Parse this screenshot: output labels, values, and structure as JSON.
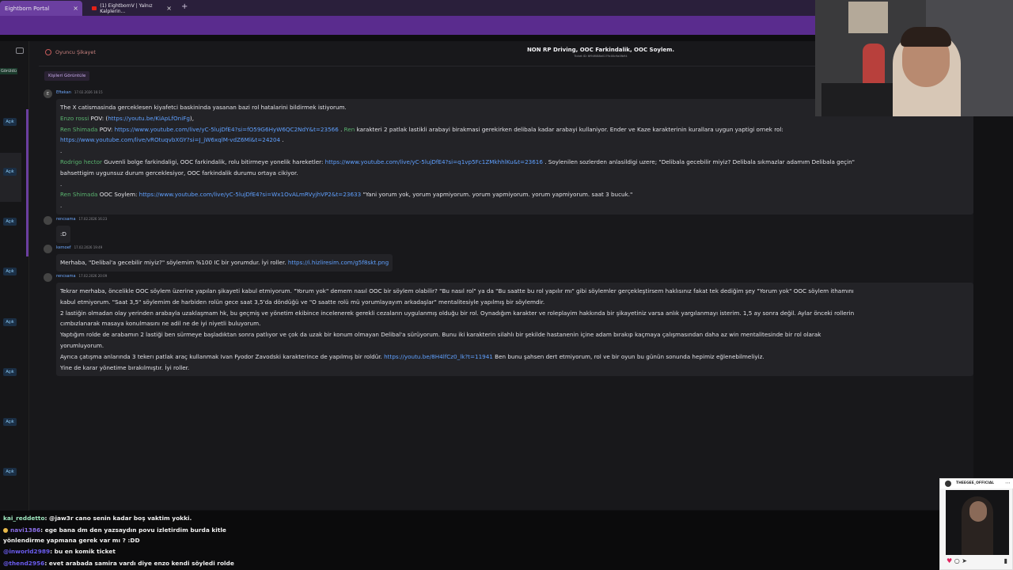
{
  "browser": {
    "tabs": [
      {
        "label": "Eightborn Portal",
        "active": true
      },
      {
        "label": "(1) EightbornV | Yalnız Kalplerin...",
        "active": false
      }
    ],
    "new_tab": "+",
    "close": "×"
  },
  "sidebar": {
    "status_top": "Görüldü",
    "status_items": [
      "Açık",
      "Açık",
      "Açık",
      "Açık",
      "Açık",
      "Açık",
      "Açık",
      "Açık"
    ]
  },
  "ticket": {
    "category": "Oyuncu Şikayet",
    "title": "NON RP Driving, OOC Farkindalik, OOC Soylem.",
    "id_line": "Ticket ID: 6f94f088e0179c00c9a0fb94",
    "people_button": "Kişileri Görüntüle"
  },
  "messages": [
    {
      "avatar_letter": "E",
      "author": "Eftekan",
      "time": "17.02.2026 16:15",
      "lines": [
        [
          {
            "t": "The X catismasinda gerceklesen kiyafetci baskininda yasanan bazi rol hatalarini bildirmek istiyorum."
          }
        ],
        [
          {
            "t": "Enzo rossi",
            "c": "g"
          },
          {
            "t": " POV: ("
          },
          {
            "t": "https://youtu.be/KiApLfOniFg",
            "c": "l"
          },
          {
            "t": "),"
          }
        ],
        [
          {
            "t": "Ren Shimada",
            "c": "g"
          },
          {
            "t": " POV: "
          },
          {
            "t": "https://www.youtube.com/live/yC-5lujDfE4?si=fO59G6HyW6QC2NdY&t=23566",
            "c": "l"
          },
          {
            "t": " . "
          },
          {
            "t": "Ren",
            "c": "g"
          },
          {
            "t": " karakteri 2 patlak lastikli arabayi birakmasi gerekirken delibala kadar arabayi kullaniyor.  Ender ve Kaze karakterinin kurallara uygun yaptigi ornek rol:"
          }
        ],
        [
          {
            "t": "https://www.youtube.com/live/vROtuqvbXGY?si=J_jW6xqlM-vdZ6Ml&t=24204",
            "c": "l"
          },
          {
            "t": " ."
          }
        ],
        [
          {
            "t": "."
          }
        ],
        [
          {
            "t": "Rodrigo hector",
            "c": "g"
          },
          {
            "t": " Guvenli bolge farkindaligi, OOC farkindalik, rolu bitirmeye yonelik hareketler: "
          },
          {
            "t": "https://www.youtube.com/live/yC-5lujDfE4?si=q1vp5Fc1ZMkhhlKu&t=23616",
            "c": "l"
          },
          {
            "t": " . Soylenilen sozlerden anlasildigi uzere; \"Delibala gecebilir miyiz? Delibala sıkmazlar adamım Delibala geçin\""
          }
        ],
        [
          {
            "t": "bahsettigim uygunsuz durum gerceklesiyor, OOC farkindalik durumu ortaya cikiyor."
          }
        ],
        [
          {
            "t": "."
          }
        ],
        [
          {
            "t": "Ren Shimada",
            "c": "g"
          },
          {
            "t": " OOC Soylem: "
          },
          {
            "t": "https://www.youtube.com/live/yC-5lujDfE4?si=Wx1OvALmRVyjhVP2&t=23633",
            "c": "l"
          },
          {
            "t": " \"Yani yorum yok, yorum yapmiyorum. yorum yapmiyorum. yorum yapmiyorum. saat 3 bucuk.\""
          }
        ],
        [
          {
            "t": "."
          }
        ]
      ]
    },
    {
      "avatar_letter": "",
      "author": "rencsama",
      "time": "17.02.2026 16:23",
      "lines": [
        [
          {
            "t": ":D"
          }
        ]
      ]
    },
    {
      "avatar_letter": "",
      "author": "kemoef",
      "time": "17.02.2026 19:49",
      "lines": [
        [
          {
            "t": "Merhaba, \"Delibal'a gecebilir miyiz?\" söylemim %100 IC bir yorumdur. İyi roller. "
          },
          {
            "t": "https://i.hizliresim.com/g5f8skt.png",
            "c": "l"
          }
        ]
      ]
    },
    {
      "avatar_letter": "",
      "author": "rencsama",
      "time": "17.02.2026 20:09",
      "lines": [
        [
          {
            "t": "Tekrar merhaba, öncelikle OOC söylem üzerine yapılan şikayeti kabul etmiyorum. \"Yorum yok\" demem nasıl OOC bir söylem olabilir? \"Bu nasıl rol\" ya da \"Bu saatte bu rol yapılır mı\" gibi söylemler gerçekleştirsem haklısınız fakat tek dediğim şey \"Yorum yok\" OOC söylem ithamını"
          }
        ],
        [
          {
            "t": "kabul etmiyorum. \"Saat 3,5\" söylemim de harbiden rolün gece saat 3,5'da döndüğü ve \"O saatte rolü mü yorumlayayım arkadaşlar\" mentalitesiyle yapılmış bir söylemdir."
          }
        ],
        [
          {
            "t": "2 lastiğin olmadan olay yerinden arabayla uzaklaşmam hk, bu geçmiş ve yönetim ekibince incelenerek gerekli cezaların uygulanmış olduğu bir rol. Oynadığım karakter ve roleplayim hakkında bir şikayetiniz varsa anlık yargılanmayı isterim. 1,5 ay sonra değil. Aylar önceki rollerin"
          }
        ],
        [
          {
            "t": "cımbızlanarak masaya konulmasını ne adil ne de iyi niyetli buluyorum."
          }
        ],
        [
          {
            "t": "Yaptığım rolde de arabamın 2 lastiği ben sürmeye başladıktan sonra patlıyor ve çok da uzak bir konum olmayan Delibal'a sürüyorum. Bunu iki karakterin silahlı bir şekilde hastanenin içine adam bırakıp kaçmaya çalışmasından daha az win mentalitesinde bir rol olarak"
          }
        ],
        [
          {
            "t": "yorumluyorum."
          }
        ],
        [
          {
            "t": "Ayrıca çatışma anlarında 3 tekerı patlak araç kullanmak Ivan Fyodor Zavodski karakterince de yapılmış bir roldür. "
          },
          {
            "t": "https://youtu.be/8H4lfCz0_lk?t=11941",
            "c": "l"
          },
          {
            "t": " Ben bunu şahsen dert etmiyorum, rol ve bir oyun bu günün sonunda hepimiz eğlenebilmeliyiz."
          }
        ],
        [
          {
            "t": "Yine de karar yönetime bırakılmıştır. İyi roller."
          }
        ]
      ]
    }
  ],
  "twitch_chat": [
    {
      "user": "kai_reddetto",
      "text": ": @jaw3r cano senin kadar boş vaktim yokki.",
      "badge": false
    },
    {
      "user": "navi1386",
      "text": ": ege bana dm den yazsaydın povu izletirdim burda kitle",
      "badge": true
    },
    {
      "user": "",
      "text": "yönlendirme yapmana gerek var mı ? :DD",
      "badge": false
    },
    {
      "user": "@inworld2989",
      "text": ": bu en komik ticket",
      "badge": false
    },
    {
      "user": "@thend2956",
      "text": ": evet arabada samira vardı diye enzo kendi söyledi rolde",
      "badge": false
    }
  ],
  "instagram": {
    "username": "THEEGEE_OFFICIAL",
    "menu": "⋯",
    "actions": [
      "♥",
      "○",
      "➤"
    ],
    "bookmark": "▮"
  },
  "colors": {
    "accent": "#6b3fa0",
    "link": "#5fa0ff",
    "name_green": "#59b26e",
    "status_open": "#8fd2ff"
  }
}
